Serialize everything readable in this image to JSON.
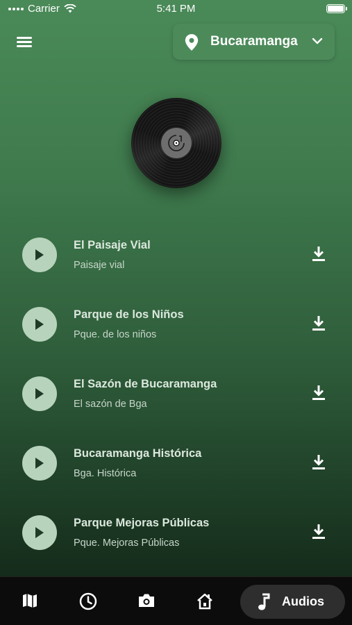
{
  "status_bar": {
    "carrier": "Carrier",
    "time": "5:41 PM"
  },
  "header": {
    "city": "Bucaramanga"
  },
  "audios": [
    {
      "title": "El Paisaje Vial",
      "subtitle": "Paisaje vial"
    },
    {
      "title": "Parque de los Niños",
      "subtitle": "Pque. de los niños"
    },
    {
      "title": "El Sazón de Bucaramanga",
      "subtitle": "El sazón de Bga"
    },
    {
      "title": "Bucaramanga Histórica",
      "subtitle": "Bga. Histórica"
    },
    {
      "title": "Parque Mejoras Públicas",
      "subtitle": "Pque. Mejoras Públicas"
    }
  ],
  "bottom_nav": {
    "items": [
      "map-icon",
      "clock-icon",
      "camera-icon",
      "home-icon"
    ],
    "active_label": "Audios",
    "active_icon": "music-note-icon"
  },
  "colors": {
    "accent": "#4c8a5a",
    "play_button": "#b7d3bb",
    "nav_background": "#0c0c0c"
  }
}
